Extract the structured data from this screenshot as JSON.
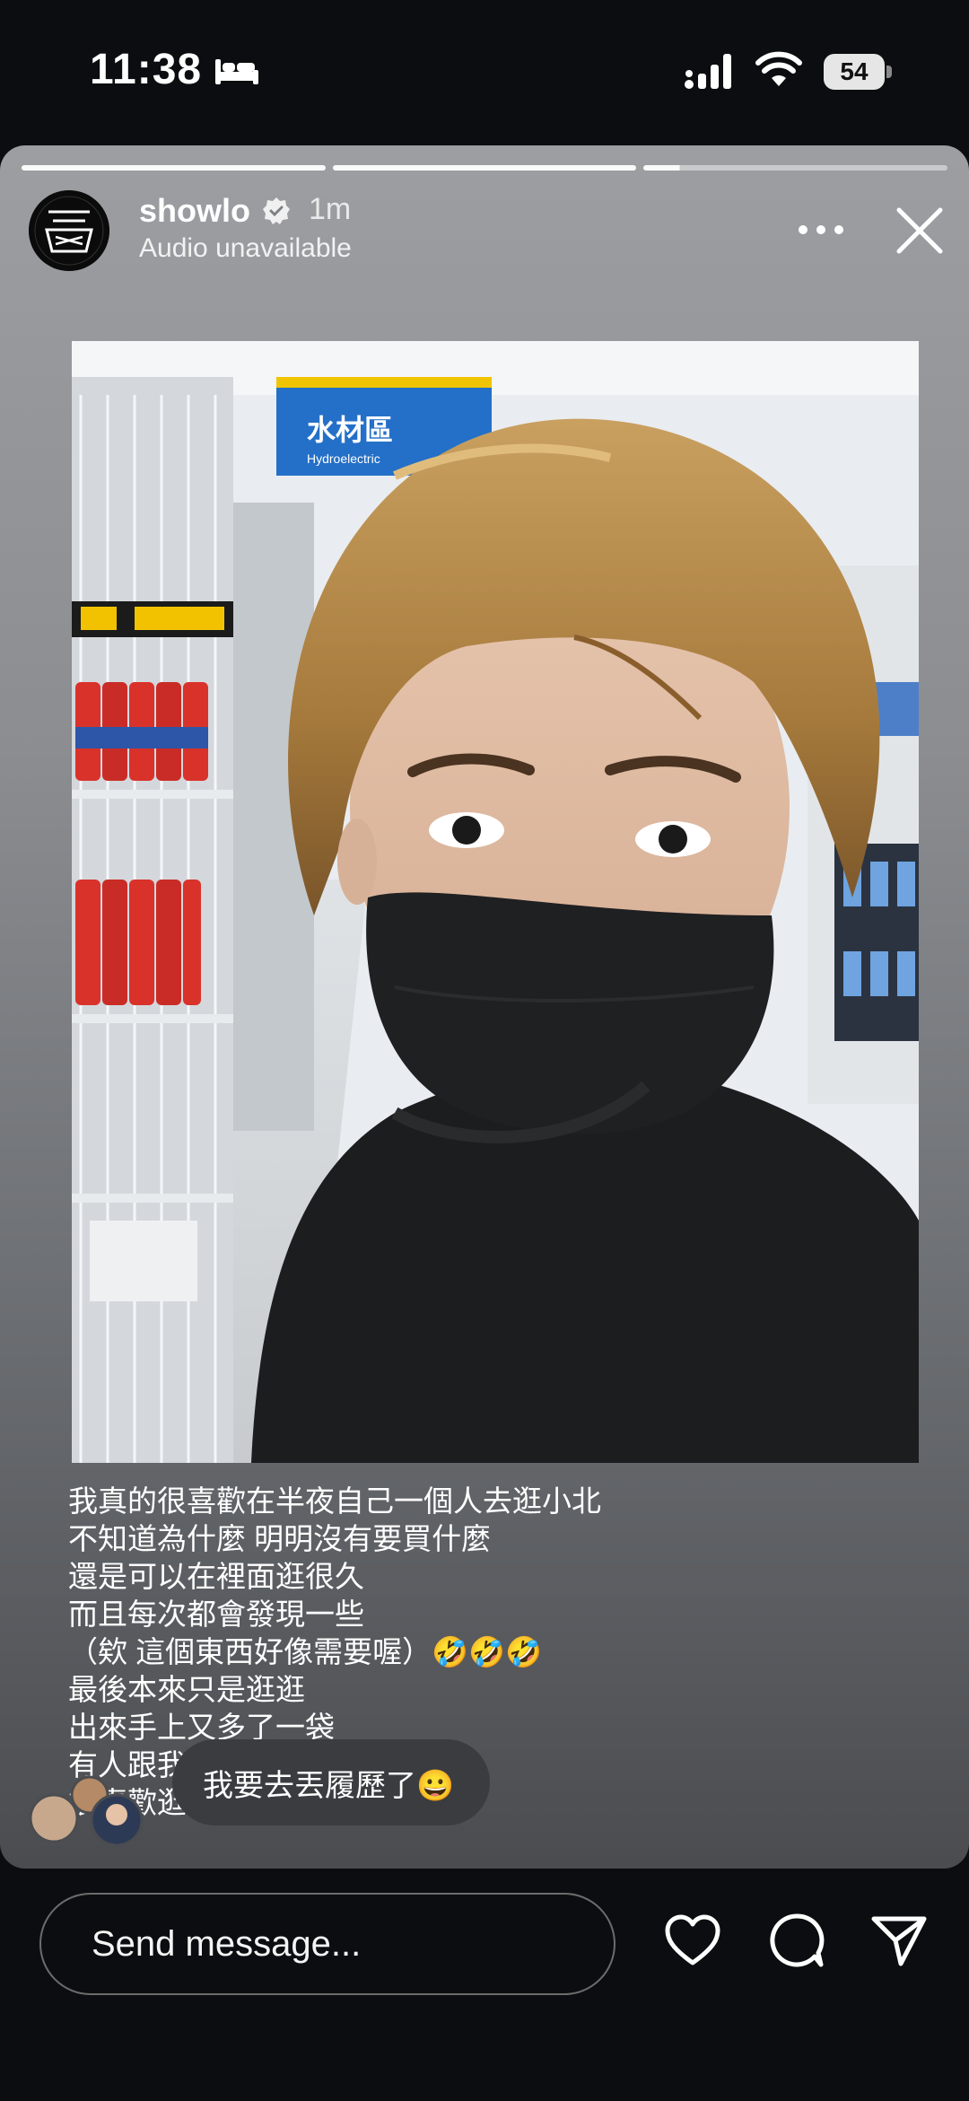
{
  "status_bar": {
    "time": "11:38",
    "battery": "54"
  },
  "story": {
    "username": "showlo",
    "time_ago": "1m",
    "audio_status": "Audio unavailable",
    "segments": 3,
    "current_segment_progress": 0.12,
    "caption_lines": [
      "我真的很喜歡在半夜自己一個人去逛小北",
      "不知道為什麼 明明沒有要買什麼",
      "還是可以在裡面逛很久",
      "而且每次都會發現一些",
      "（欸 這個東西好像需要喔）🤣🤣🤣",
      "最後本來只是逛逛",
      "出來手上又多了一袋",
      "有人跟我",
      "很喜歡逛"
    ],
    "store_sign": {
      "title": "水材區",
      "subtitle": "Hydroelectric"
    },
    "reply": {
      "text": "我要去丟履歷了😀"
    }
  },
  "bottom_bar": {
    "message_placeholder": "Send message..."
  },
  "icons": [
    "bed-icon",
    "signal-icon",
    "wifi-icon",
    "verified-icon",
    "more-icon",
    "close-icon",
    "heart-icon",
    "comment-icon",
    "share-icon"
  ]
}
